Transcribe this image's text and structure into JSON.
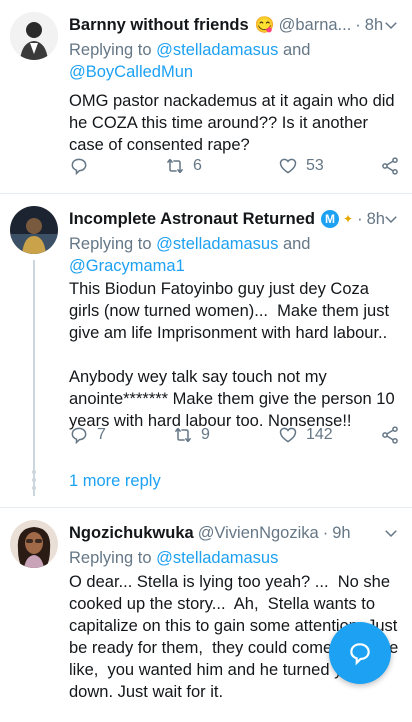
{
  "tweets": [
    {
      "name": "Barnny without friends",
      "emoji": "😋",
      "handle": "@barna...",
      "time": "8h",
      "replying_prefix": "Replying to ",
      "replying_users": [
        "@stelladamasus",
        " and ",
        "@BoyCalledMun"
      ],
      "text": "OMG pastor nackademus at it again who did he COZA this time around?? Is it another case of consented rape?",
      "retweets": "6",
      "likes": "53"
    },
    {
      "name": "Incomplete Astronaut Returned",
      "badge": "M",
      "time": "8h",
      "replying_prefix": "Replying to ",
      "replying_users": [
        "@stelladamasus",
        " and ",
        "@Gracymama1"
      ],
      "text": "This Biodun Fatoyinbo guy just dey Coza girls (now turned women)...  Make them just give am life Imprisonment with hard labour..\n\nAnybody wey talk say touch not my anointe******* Make them give the person 10 years with hard labour too. Nonsense!!",
      "replies": "7",
      "retweets": "9",
      "likes": "142"
    },
    {
      "name": "Ngozichukwuka",
      "handle": "@VivienNgozika",
      "time": "9h",
      "replying_prefix": "Replying to ",
      "replying_users": [
        "@stelladamasus"
      ],
      "text": "O dear... Stella is lying too yeah? ...  No she cooked up the story...  Ah,  Stella wants to capitalize on this to gain some attention. Just be ready for them,  they could come  with the like,  you wanted him and he turned you down. Just wait for it."
    }
  ],
  "more_replies": "1 more reply",
  "colors": {
    "accent": "#1da1f2",
    "muted": "#657786",
    "text": "#14171a"
  },
  "icons": [
    "reply-icon",
    "retweet-icon",
    "like-icon",
    "share-icon",
    "chevron-down-icon",
    "compose-reply-icon"
  ]
}
